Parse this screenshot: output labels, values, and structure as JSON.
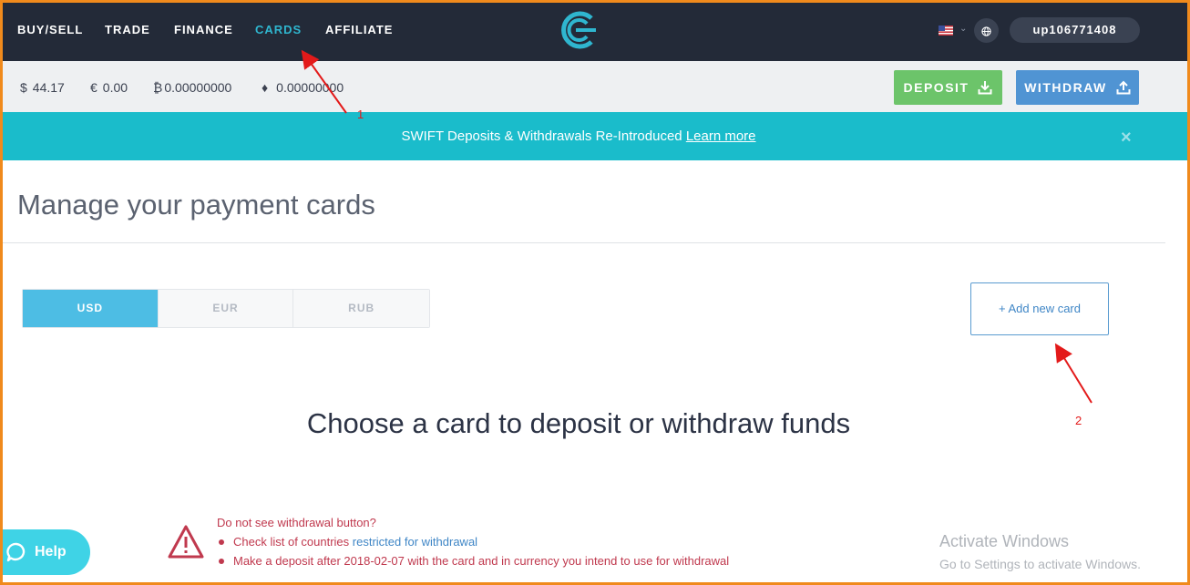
{
  "nav": {
    "items": [
      {
        "label": "BUY/SELL"
      },
      {
        "label": "TRADE"
      },
      {
        "label": "FINANCE"
      },
      {
        "label": "CARDS",
        "active": true
      },
      {
        "label": "AFFILIATE"
      }
    ],
    "language_flag": "us-flag-icon",
    "globe_icon": "globe-icon",
    "username": "up106771408"
  },
  "balances": {
    "usd": {
      "symbol": "$",
      "value": "44.17"
    },
    "eur": {
      "symbol": "€",
      "value": "0.00"
    },
    "btc": {
      "symbol": "₿",
      "value": "0.00000000"
    },
    "eth": {
      "symbol": "♦",
      "value": "0.00000000"
    }
  },
  "actions": {
    "deposit_label": "DEPOSIT",
    "withdraw_label": "WITHDRAW"
  },
  "banner": {
    "text": "SWIFT Deposits & Withdrawals Re-Introduced",
    "link": "Learn more",
    "close": "×"
  },
  "page": {
    "title": "Manage your payment cards",
    "tabs": [
      {
        "label": "USD",
        "active": true
      },
      {
        "label": "EUR"
      },
      {
        "label": "RUB"
      }
    ],
    "add_card_label": "+ Add new card",
    "empty_message": "Choose a card to deposit or withdraw funds"
  },
  "warning": {
    "title": "Do not see withdrawal button?",
    "item1_prefix": "Check list of countries",
    "item1_link": "restricted for withdrawal",
    "item2": "Make a deposit after 2018-02-07 with the card and in currency you intend to use for withdrawal"
  },
  "help": {
    "label": "Help"
  },
  "watermark": {
    "line1": "Activate Windows",
    "line2": "Go to Settings to activate Windows."
  },
  "annotations": {
    "label1": "1",
    "label2": "2",
    "color": "#e31a1a"
  },
  "colors": {
    "nav_bg": "#232a38",
    "accent": "#2fb6cf",
    "deposit": "#6cc46a",
    "withdraw": "#5094d3",
    "banner": "#1abccb",
    "warning": "#c0394e"
  }
}
